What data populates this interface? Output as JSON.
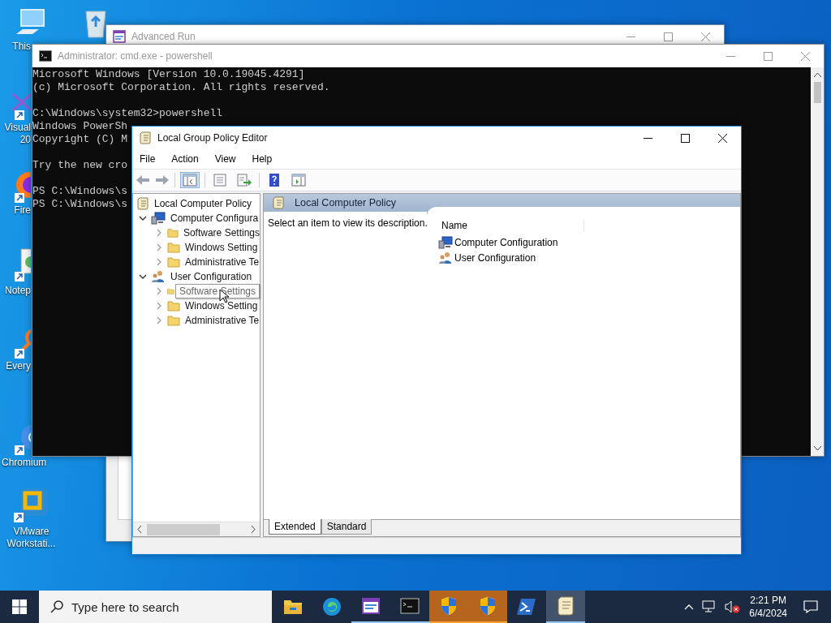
{
  "desktop": {
    "icons": [
      {
        "kind": "computer",
        "label": [
          "This"
        ]
      },
      {
        "kind": "recycle-bin"
      },
      {
        "kind": "visual-studio",
        "label": [
          "Visual",
          "20"
        ]
      },
      {
        "kind": "firefox",
        "label": [
          "Fire"
        ]
      },
      {
        "kind": "notepad",
        "label": [
          "Notep"
        ]
      },
      {
        "kind": "everything",
        "label": [
          "Every"
        ]
      },
      {
        "kind": "chromium",
        "label": [
          "Chromium"
        ]
      },
      {
        "kind": "vmware",
        "label": [
          "VMware",
          "Workstati..."
        ]
      }
    ]
  },
  "advanced_run": {
    "title": "Advanced Run"
  },
  "cmd": {
    "title": "Administrator: cmd.exe - powershell",
    "paragraphs": [
      [
        "Microsoft Windows [Version 10.0.19045.4291]",
        "(c) Microsoft Corporation. All rights reserved."
      ],
      [
        "C:\\Windows\\system32>powershell",
        "Windows PowerSh",
        "Copyright (C) M"
      ],
      [
        "Try the new cro"
      ],
      [
        "PS C:\\Windows\\s",
        "PS C:\\Windows\\s"
      ]
    ]
  },
  "gpedit": {
    "title": "Local Group Policy Editor",
    "menu": [
      "File",
      "Action",
      "View",
      "Help"
    ],
    "toolbar": [
      [
        {
          "kind": "back",
          "disabled": true,
          "pressed": false
        },
        {
          "kind": "forward",
          "disabled": true,
          "pressed": false
        }
      ],
      [
        {
          "kind": "console-tree",
          "disabled": false,
          "pressed": true
        }
      ],
      [
        {
          "kind": "properties",
          "disabled": false,
          "pressed": false
        },
        {
          "kind": "export",
          "disabled": false,
          "pressed": false
        }
      ],
      [
        {
          "kind": "help",
          "disabled": false,
          "pressed": false
        },
        {
          "kind": "view",
          "disabled": false,
          "pressed": false
        }
      ]
    ],
    "tree": {
      "label": "Local Computer Policy",
      "children": [
        {
          "label": "Computer Configura",
          "expanded": true,
          "children": [
            {
              "label": "Software Settings",
              "expanded": false,
              "tooltip": false
            },
            {
              "label": "Windows Setting",
              "expanded": false,
              "tooltip": false
            },
            {
              "label": "Administrative Te",
              "expanded": false,
              "tooltip": false
            }
          ]
        },
        {
          "label": "User Configuration",
          "expanded": true,
          "children": [
            {
              "label": "Software Settings",
              "expanded": false,
              "tooltip": true
            },
            {
              "label": "Windows Setting",
              "expanded": false,
              "tooltip": false
            },
            {
              "label": "Administrative Te",
              "expanded": false,
              "tooltip": false
            }
          ]
        }
      ]
    },
    "header": "Local Computer Policy",
    "description": "Select an item to view its description.",
    "list": {
      "columns": [
        "Name"
      ],
      "rows": [
        "Computer Configuration",
        "User Configuration"
      ]
    },
    "tabs": [
      {
        "label": "Extended",
        "selected": true
      },
      {
        "label": "Standard",
        "selected": false
      }
    ]
  },
  "taskbar": {
    "search": {
      "placeholder": "Type here to search"
    },
    "apps": [
      {
        "kind": "folder",
        "open": false,
        "flashing": false,
        "active": false
      },
      {
        "kind": "edge",
        "open": false,
        "flashing": false,
        "active": false
      },
      {
        "kind": "advanced-run",
        "open": true,
        "flashing": false,
        "active": false
      },
      {
        "kind": "terminal",
        "open": true,
        "flashing": false,
        "active": false
      },
      {
        "kind": "shield",
        "open": true,
        "flashing": true,
        "active": false
      },
      {
        "kind": "shield",
        "open": true,
        "flashing": true,
        "active": false
      },
      {
        "kind": "powershell",
        "open": false,
        "flashing": false,
        "active": false
      },
      {
        "kind": "policy",
        "open": true,
        "flashing": false,
        "active": true
      }
    ],
    "clock": {
      "time": "2:21 PM",
      "date": "6/4/2024"
    }
  }
}
